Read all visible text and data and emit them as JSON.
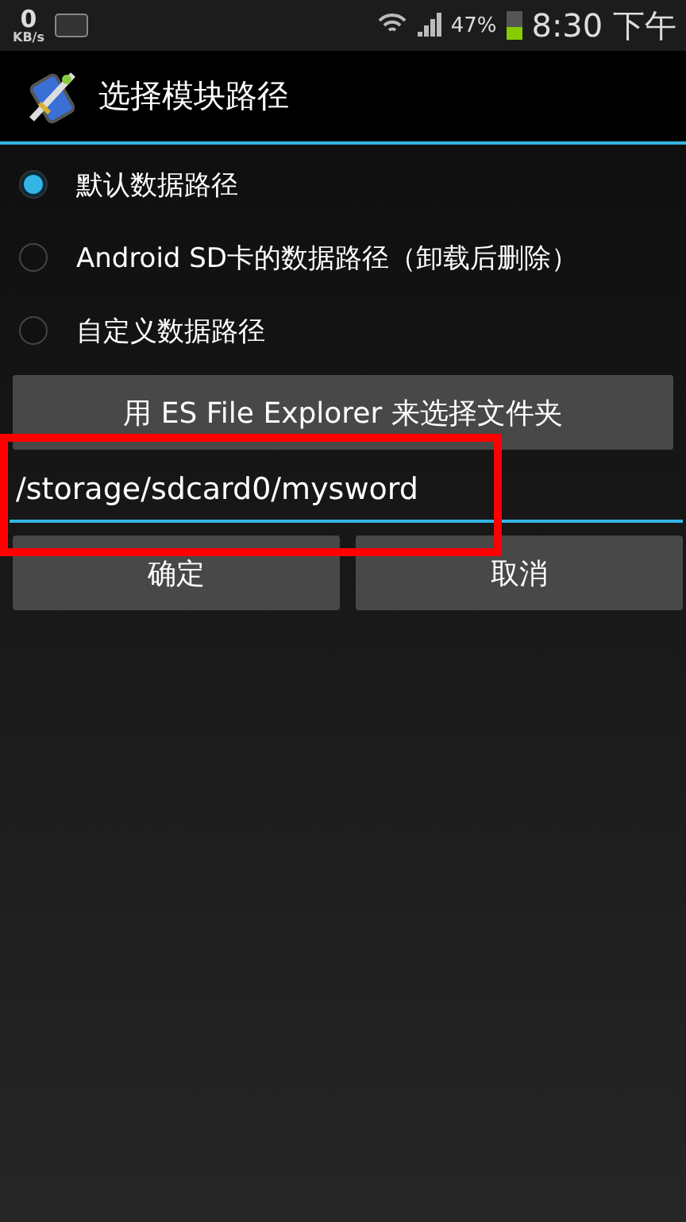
{
  "status_bar": {
    "speed_value": "0",
    "speed_unit": "KB/s",
    "battery_percent": "47%",
    "battery": {
      "level": 0.47
    },
    "time": "8:30 下午"
  },
  "title_bar": {
    "title": "选择模块路径"
  },
  "options": [
    {
      "label": "默认数据路径",
      "selected": true
    },
    {
      "label": "Android SD卡的数据路径（卸载后删除）",
      "selected": false
    },
    {
      "label": "自定义数据路径",
      "selected": false
    }
  ],
  "browse_button": "用 ES File Explorer 来选择文件夹",
  "path_field": {
    "value": "/storage/sdcard0/mysword",
    "focused": true
  },
  "buttons": [
    "确定",
    "取消"
  ],
  "annotation": {
    "kind": "rectangle"
  }
}
